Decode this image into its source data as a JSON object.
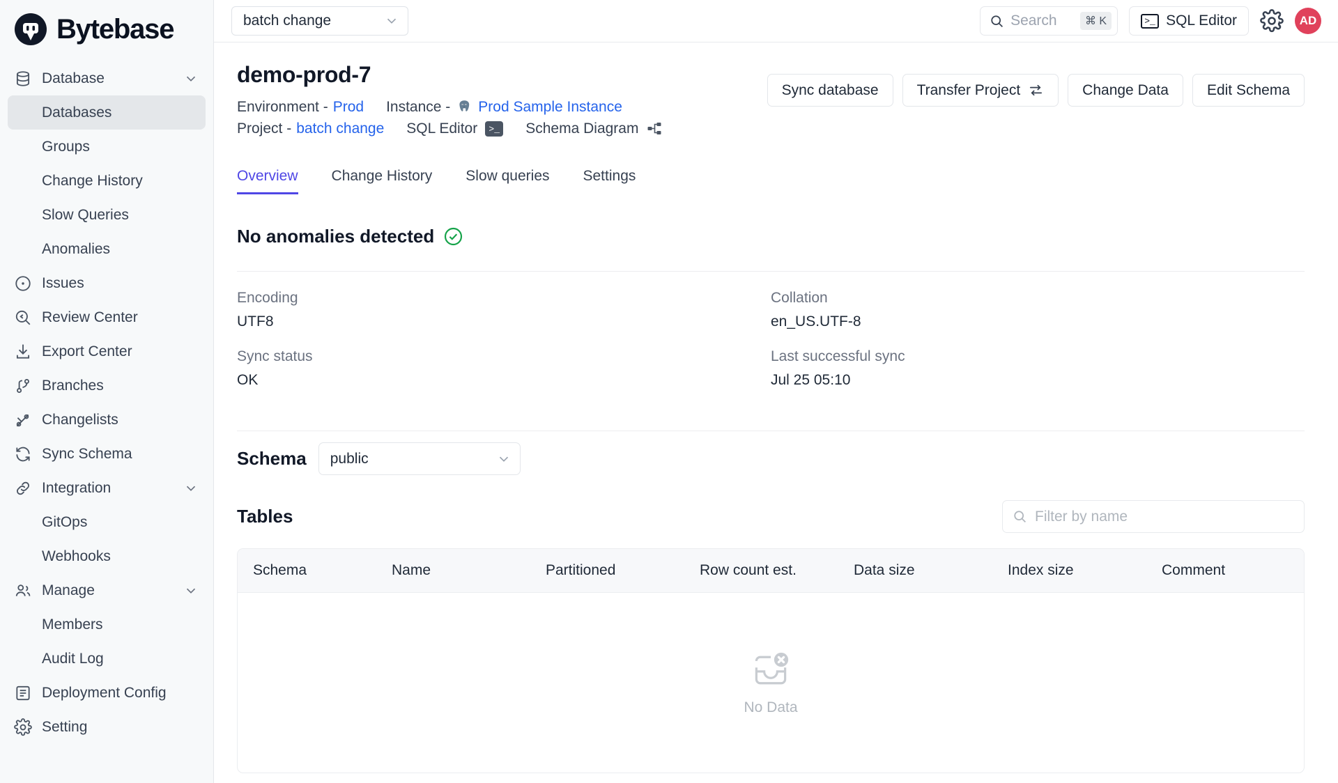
{
  "brand": {
    "name": "Bytebase",
    "logo_icon": "bytebase-logo-icon"
  },
  "sidebar": {
    "items": [
      {
        "label": "Database",
        "icon": "database-icon",
        "type": "group",
        "expanded": true
      },
      {
        "label": "Databases",
        "icon": "",
        "type": "sub",
        "active": true
      },
      {
        "label": "Groups",
        "icon": "",
        "type": "sub",
        "active": false
      },
      {
        "label": "Change History",
        "icon": "",
        "type": "sub",
        "active": false
      },
      {
        "label": "Slow Queries",
        "icon": "",
        "type": "sub",
        "active": false
      },
      {
        "label": "Anomalies",
        "icon": "",
        "type": "sub",
        "active": false
      },
      {
        "label": "Issues",
        "icon": "issues-circle-dot-icon",
        "type": "item"
      },
      {
        "label": "Review Center",
        "icon": "review-magnifier-code-icon",
        "type": "item"
      },
      {
        "label": "Export Center",
        "icon": "export-download-icon",
        "type": "item"
      },
      {
        "label": "Branches",
        "icon": "branch-icon",
        "type": "item"
      },
      {
        "label": "Changelists",
        "icon": "changelists-pencil-icon",
        "type": "item"
      },
      {
        "label": "Sync Schema",
        "icon": "sync-refresh-icon",
        "type": "item"
      },
      {
        "label": "Integration",
        "icon": "link-chain-icon",
        "type": "group",
        "expanded": true
      },
      {
        "label": "GitOps",
        "icon": "",
        "type": "sub",
        "active": false
      },
      {
        "label": "Webhooks",
        "icon": "",
        "type": "sub",
        "active": false
      },
      {
        "label": "Manage",
        "icon": "users-icon",
        "type": "group",
        "expanded": true
      },
      {
        "label": "Members",
        "icon": "",
        "type": "sub",
        "active": false
      },
      {
        "label": "Audit Log",
        "icon": "",
        "type": "sub",
        "active": false
      },
      {
        "label": "Deployment Config",
        "icon": "document-list-icon",
        "type": "item"
      },
      {
        "label": "Setting",
        "icon": "gear-icon",
        "type": "item"
      }
    ]
  },
  "topbar": {
    "project_selector": {
      "value": "batch change",
      "chevron_icon": "chevron-down-icon"
    },
    "search": {
      "placeholder": "Search",
      "shortcut": "⌘ K",
      "icon": "search-icon"
    },
    "sql_editor": {
      "label": "SQL Editor",
      "icon": "terminal-icon",
      "glyph": ">_"
    },
    "settings": {
      "icon": "gear-icon"
    },
    "avatar": {
      "initials": "AD",
      "color": "#e0415b"
    }
  },
  "page": {
    "title": "demo-prod-7",
    "meta": {
      "environment_label": "Environment -",
      "environment_value": "Prod",
      "instance_label": "Instance -",
      "instance_value": "Prod Sample Instance",
      "instance_engine_icon": "postgresql-elephant-icon",
      "project_label": "Project -",
      "project_value": "batch change",
      "sql_editor_label": "SQL Editor",
      "sql_editor_icon": "terminal-icon",
      "schema_diagram_label": "Schema Diagram",
      "schema_diagram_icon": "schema-diagram-icon"
    },
    "actions": [
      {
        "label": "Sync database",
        "icon": ""
      },
      {
        "label": "Transfer Project",
        "icon": "transfer-arrows-icon"
      },
      {
        "label": "Change Data",
        "icon": ""
      },
      {
        "label": "Edit Schema",
        "icon": ""
      }
    ],
    "tabs": [
      {
        "label": "Overview",
        "active": true
      },
      {
        "label": "Change History",
        "active": false
      },
      {
        "label": "Slow queries",
        "active": false
      },
      {
        "label": "Settings",
        "active": false
      }
    ],
    "anomaly": {
      "text": "No anomalies detected",
      "icon": "check-circle-icon",
      "color": "#16a34a"
    },
    "info": [
      {
        "label": "Encoding",
        "value": "UTF8"
      },
      {
        "label": "Collation",
        "value": "en_US.UTF-8"
      },
      {
        "label": "Sync status",
        "value": "OK"
      },
      {
        "label": "Last successful sync",
        "value": "Jul 25 05:10"
      }
    ],
    "schema": {
      "label": "Schema",
      "selected": "public",
      "chevron_icon": "chevron-down-icon"
    },
    "tables": {
      "title": "Tables",
      "filter": {
        "placeholder": "Filter by name",
        "value": "",
        "icon": "search-icon"
      },
      "columns": [
        "Schema",
        "Name",
        "Partitioned",
        "Row count est.",
        "Data size",
        "Index size",
        "Comment"
      ],
      "rows": [],
      "empty": {
        "text": "No Data",
        "icon": "no-data-inbox-icon"
      }
    }
  },
  "accent": {
    "primary": "#4f46e5",
    "link": "#2563eb",
    "success": "#16a34a"
  }
}
